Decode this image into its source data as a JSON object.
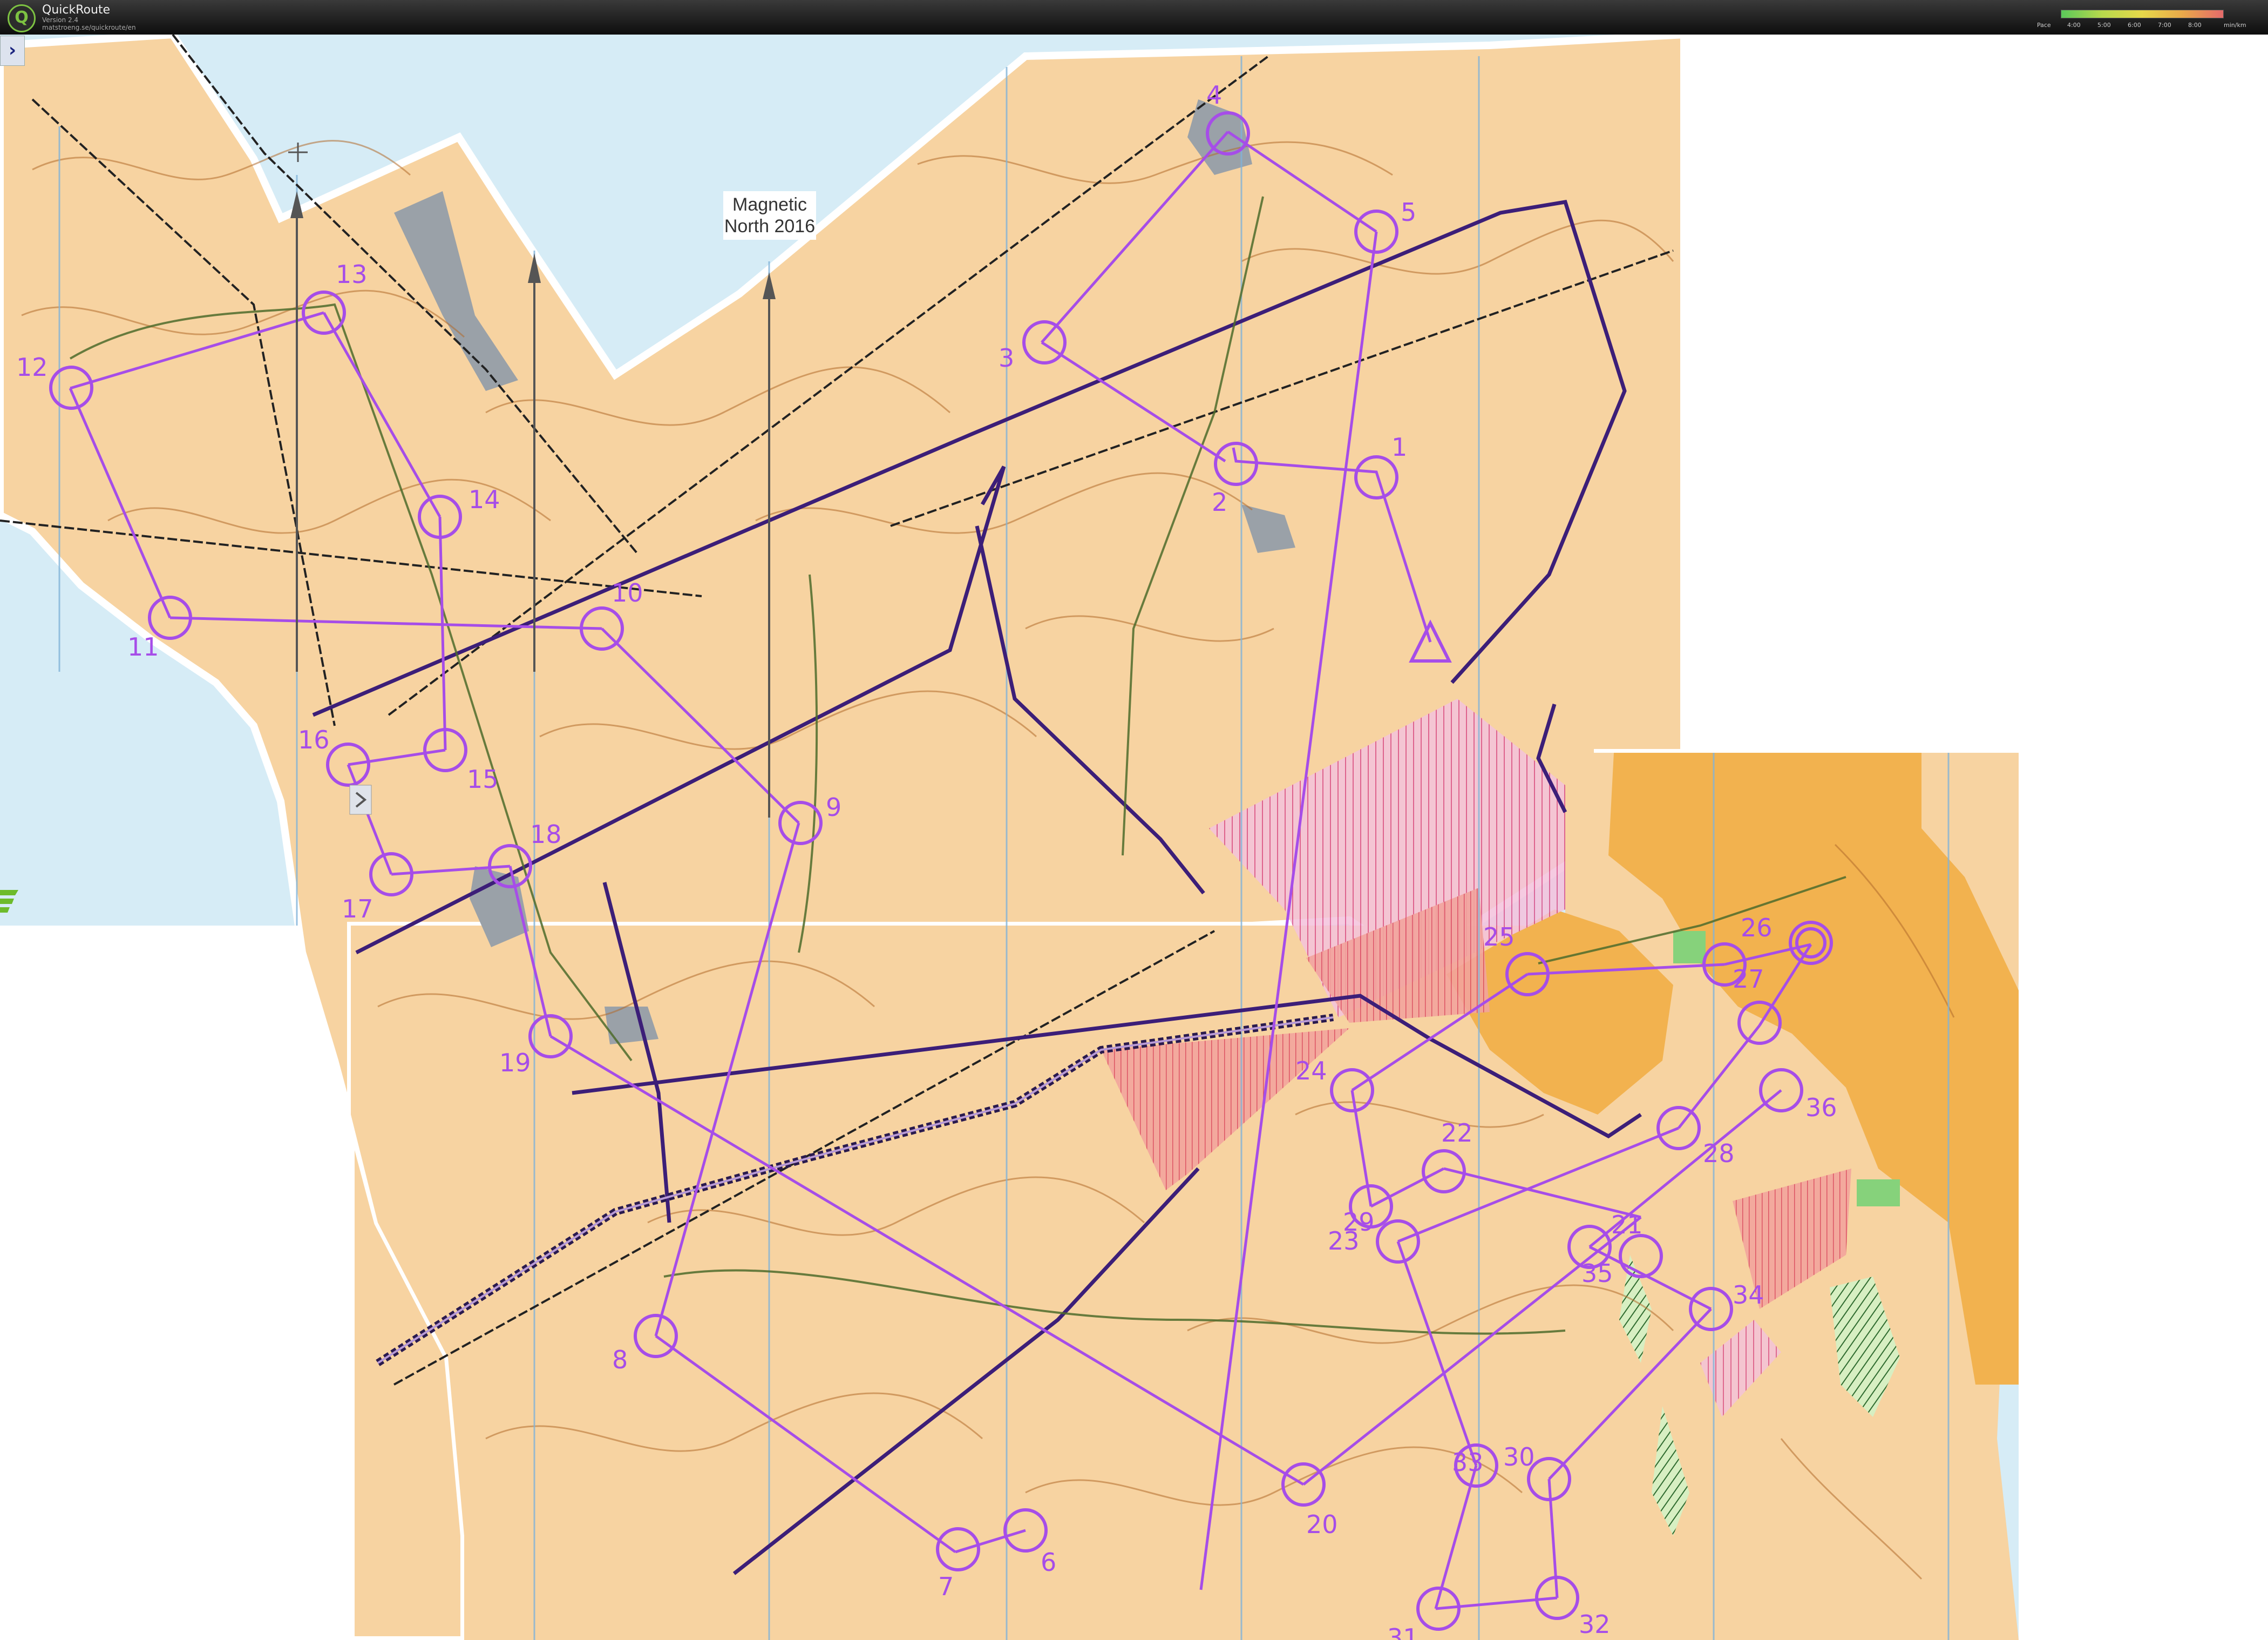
{
  "app": {
    "title": "QuickRoute",
    "version": "Version 2.4",
    "url": "matstroeng.se/quickroute/en"
  },
  "pace_legend": {
    "label": "Pace",
    "ticks": [
      "4:00",
      "5:00",
      "6:00",
      "7:00",
      "8:00"
    ],
    "unit": "min/km"
  },
  "map": {
    "north_label_line1": "Magnetic",
    "north_label_line2": "North 2016",
    "colors": {
      "water": "#d6ecf6",
      "terrain": "#f7d3a1",
      "open_land": "#f2b24f",
      "course": "#a64de8",
      "boundary": "#3c1e78",
      "forbidden": "#d94f8a",
      "rock": "#9aa1a8"
    },
    "controls": [
      {
        "num": "1"
      },
      {
        "num": "2"
      },
      {
        "num": "3"
      },
      {
        "num": "4"
      },
      {
        "num": "5"
      },
      {
        "num": "6"
      },
      {
        "num": "7"
      },
      {
        "num": "8"
      },
      {
        "num": "9"
      },
      {
        "num": "10"
      },
      {
        "num": "11"
      },
      {
        "num": "12"
      },
      {
        "num": "13"
      },
      {
        "num": "14"
      },
      {
        "num": "15"
      },
      {
        "num": "16"
      },
      {
        "num": "17"
      },
      {
        "num": "18"
      },
      {
        "num": "19"
      },
      {
        "num": "20"
      },
      {
        "num": "21"
      },
      {
        "num": "22"
      },
      {
        "num": "23"
      },
      {
        "num": "24"
      },
      {
        "num": "25"
      },
      {
        "num": "26"
      },
      {
        "num": "27"
      },
      {
        "num": "28"
      },
      {
        "num": "29"
      },
      {
        "num": "30"
      },
      {
        "num": "31"
      },
      {
        "num": "32"
      },
      {
        "num": "33"
      },
      {
        "num": "34"
      },
      {
        "num": "35"
      },
      {
        "num": "36"
      }
    ]
  },
  "icons": {
    "sidebar_toggle": "chevron-right-icon",
    "logo": "quickroute-logo-icon",
    "start": "start-triangle-icon",
    "north_arrow": "north-arrow-icon"
  }
}
